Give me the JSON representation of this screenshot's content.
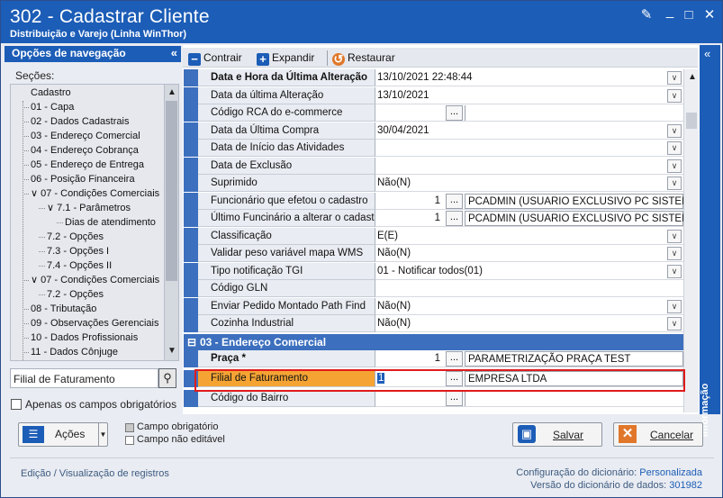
{
  "window": {
    "title": "302 - Cadastrar Cliente",
    "subtitle": "Distribuição e Varejo (Linha WinThor)"
  },
  "nav": {
    "header": "Opções de navegação",
    "section_label": "Seções:",
    "tree": [
      {
        "label": "Cadastro",
        "level": 0
      },
      {
        "label": "01 - Capa",
        "level": 1
      },
      {
        "label": "02 - Dados Cadastrais",
        "level": 1
      },
      {
        "label": "03 - Endereço Comercial",
        "level": 1
      },
      {
        "label": "04 - Endereço Cobrança",
        "level": 1
      },
      {
        "label": "05 - Endereço de Entrega",
        "level": 1
      },
      {
        "label": "06 - Posição Financeira",
        "level": 1
      },
      {
        "label": "07 - Condições Comerciais",
        "level": 1
      },
      {
        "label": "7.1 - Parâmetros",
        "level": 2
      },
      {
        "label": "Dias de atendimento",
        "level": 3
      },
      {
        "label": "7.2 - Opções",
        "level": 2
      },
      {
        "label": "7.3 - Opções I",
        "level": 2
      },
      {
        "label": "7.4 - Opções II",
        "level": 2
      },
      {
        "label": "07 - Condições Comerciais",
        "level": 1
      },
      {
        "label": "7.2 - Opções",
        "level": 2
      },
      {
        "label": "08 - Tributação",
        "level": 1
      },
      {
        "label": "09 - Observações Gerenciais",
        "level": 1
      },
      {
        "label": "10 - Dados Profissionais",
        "level": 1
      },
      {
        "label": "11 - Dados Cônjuge",
        "level": 1
      }
    ],
    "search_value": "Filial de Faturamento",
    "only_required_label": "Apenas os campos obrigatórios"
  },
  "toolbar": {
    "collapse_label": "Contrair",
    "expand_label": "Expandir",
    "restore_label": "Restaurar"
  },
  "grid": {
    "rows": [
      {
        "label": "Data e Hora da Última Alteração",
        "value": "13/10/2021 22:48:44",
        "dropdown": true,
        "bold": true
      },
      {
        "label": "Data da última Alteração",
        "value": "13/10/2021",
        "dropdown": true
      },
      {
        "label": "Código RCA do e-commerce",
        "value": "",
        "ellipsis": true
      },
      {
        "label": "Data da Última Compra",
        "value": "30/04/2021",
        "dropdown": true
      },
      {
        "label": "Data de Início das Atividades",
        "value": "",
        "dropdown": true
      },
      {
        "label": "Data de Exclusão",
        "value": "",
        "dropdown": true
      },
      {
        "label": "Suprimido",
        "value": "Não(N)",
        "dropdown": true
      },
      {
        "label": "Funcionário que efetou o cadastro",
        "value": "1",
        "ellipsis": true,
        "desc": "PCADMIN (USUARIO EXCLUSIVO PC SISTEMAS)"
      },
      {
        "label": "Último Funcinário a alterar o cadastro",
        "value": "1",
        "ellipsis": true,
        "desc": "PCADMIN (USUARIO EXCLUSIVO PC SISTEMAS)"
      },
      {
        "label": "Classificação",
        "value": "E(E)",
        "dropdown": true
      },
      {
        "label": "Validar peso variável mapa WMS",
        "value": "Não(N)",
        "dropdown": true
      },
      {
        "label": "Tipo notificação TGI",
        "value": "01 - Notificar todos(01)",
        "dropdown": true
      },
      {
        "label": "Código GLN",
        "value": ""
      },
      {
        "label": "Enviar Pedido Montado Path Find",
        "value": "Não(N)",
        "dropdown": true
      },
      {
        "label": "Cozinha Industrial",
        "value": "Não(N)",
        "dropdown": true
      }
    ],
    "category": "03 - Endereço Comercial",
    "rows2": [
      {
        "label": "Praça *",
        "value": "1",
        "ellipsis": true,
        "desc": "PARAMETRIZAÇÃO PRAÇA TEST",
        "bold": true
      },
      {
        "label": "Filial de Faturamento",
        "value": "1",
        "ellipsis": true,
        "desc": "EMPRESA LTDA",
        "selected": true
      },
      {
        "label": "Código do Bairro",
        "value": "",
        "ellipsis": true
      }
    ]
  },
  "side_tab": "Informação",
  "footer": {
    "actions_label": "Ações",
    "legend_required": "Campo obrigatório",
    "legend_not_editable": "Campo não editável",
    "save_label": "Salvar",
    "cancel_label": "Cancelar",
    "status_text": "Edição / Visualização de registros",
    "dict_config_label": "Configuração do dicionário:",
    "dict_config_value": "Personalizada",
    "dict_version_label": "Versão do dicionário de dados:",
    "dict_version_value": "301982"
  },
  "colors": {
    "titlebar": "#1c5db7",
    "category": "#3c6fbe",
    "selected_row": "#f5a434",
    "highlight": "#e01b1b"
  }
}
